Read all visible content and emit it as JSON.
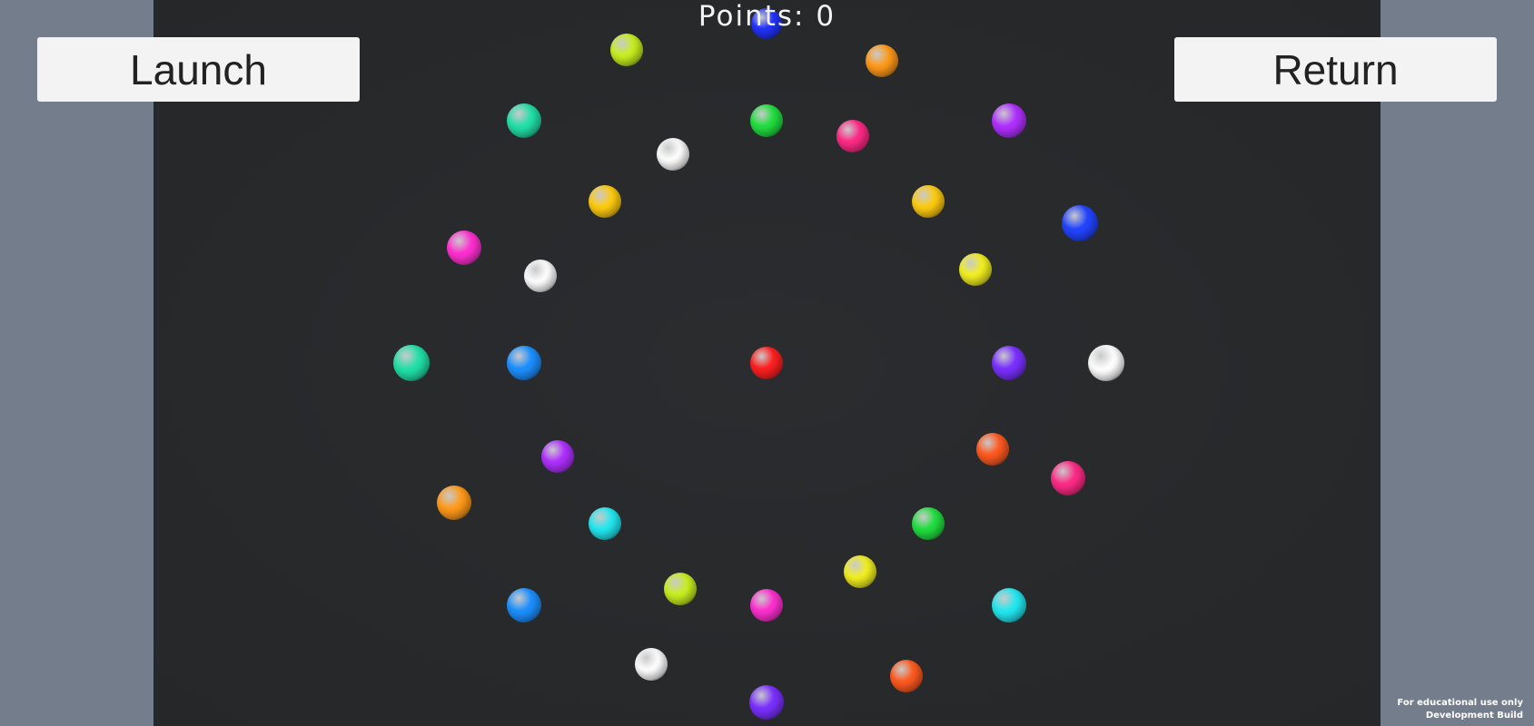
{
  "hud": {
    "score_text": "Points: 0"
  },
  "buttons": {
    "launch_label": "Launch",
    "return_label": "Return"
  },
  "watermark": {
    "line1": "For educational use only",
    "line2": "Development Build"
  },
  "colors": {
    "background": "#737d8c",
    "arena": "#27292b"
  },
  "balls": [
    {
      "color": "#2233ff"
    },
    {
      "color": "#c8f020"
    },
    {
      "color": "#ff9a1a"
    },
    {
      "color": "#22e0a8"
    },
    {
      "color": "#22e040"
    },
    {
      "color": "#ff2a86"
    },
    {
      "color": "#b030ff"
    },
    {
      "color": "#ffffff"
    },
    {
      "color": "#ffcc10"
    },
    {
      "color": "#ffcc10"
    },
    {
      "color": "#2244ff"
    },
    {
      "color": "#ff30d0"
    },
    {
      "color": "#ffffff"
    },
    {
      "color": "#f2f020"
    },
    {
      "color": "#22e0a8"
    },
    {
      "color": "#1c90ff"
    },
    {
      "color": "#ff2020"
    },
    {
      "color": "#7a30ff"
    },
    {
      "color": "#ffffff"
    },
    {
      "color": "#ff5a20"
    },
    {
      "color": "#b030ff"
    },
    {
      "color": "#ff2a86"
    },
    {
      "color": "#ff9a1a"
    },
    {
      "color": "#22e8f0"
    },
    {
      "color": "#22e040"
    },
    {
      "color": "#f2f020"
    },
    {
      "color": "#c8f020"
    },
    {
      "color": "#1c90ff"
    },
    {
      "color": "#ff30d0"
    },
    {
      "color": "#22e8f0"
    },
    {
      "color": "#ffffff"
    },
    {
      "color": "#ff5a20"
    },
    {
      "color": "#7a30ff"
    }
  ]
}
